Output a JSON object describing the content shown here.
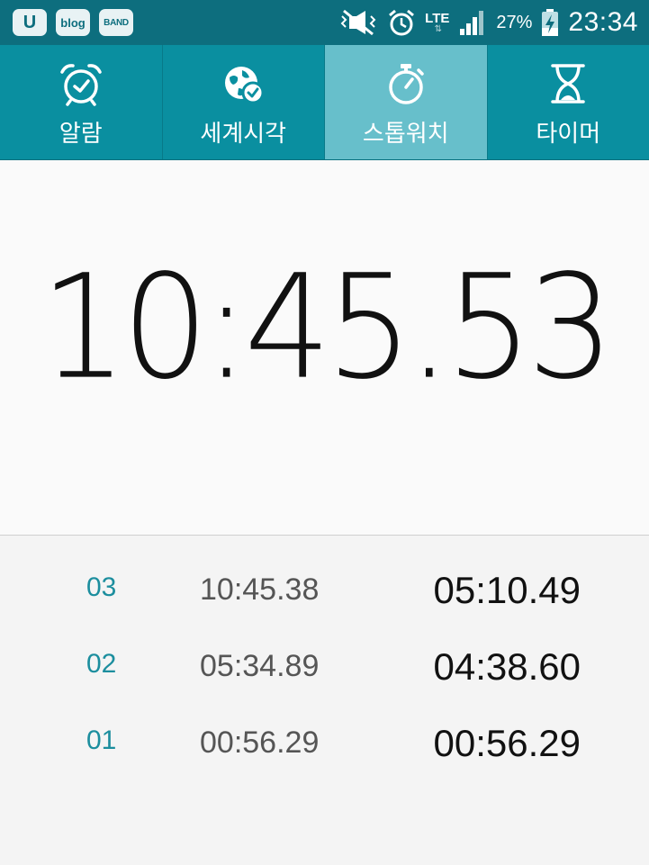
{
  "status_bar": {
    "app_badges": [
      "U",
      "blog",
      "BAND"
    ],
    "network": "LTE",
    "battery": "27%",
    "time": "23:34"
  },
  "tabs": [
    {
      "label": "알람",
      "icon": "alarm-clock-icon",
      "active": false
    },
    {
      "label": "세계시각",
      "icon": "globe-check-icon",
      "active": false
    },
    {
      "label": "스톱워치",
      "icon": "stopwatch-icon",
      "active": true
    },
    {
      "label": "타이머",
      "icon": "hourglass-icon",
      "active": false
    }
  ],
  "stopwatch": {
    "elapsed": "10:45.53"
  },
  "laps": [
    {
      "number": "03",
      "total": "10:45.38",
      "split": "05:10.49"
    },
    {
      "number": "02",
      "total": "05:34.89",
      "split": "04:38.60"
    },
    {
      "number": "01",
      "total": "00:56.29",
      "split": "00:56.29"
    }
  ],
  "colors": {
    "status_bar": "#0d6e7e",
    "tab_bar": "#0a8fa0",
    "tab_active": "#67bfcb",
    "lap_number": "#1c8e9e"
  }
}
